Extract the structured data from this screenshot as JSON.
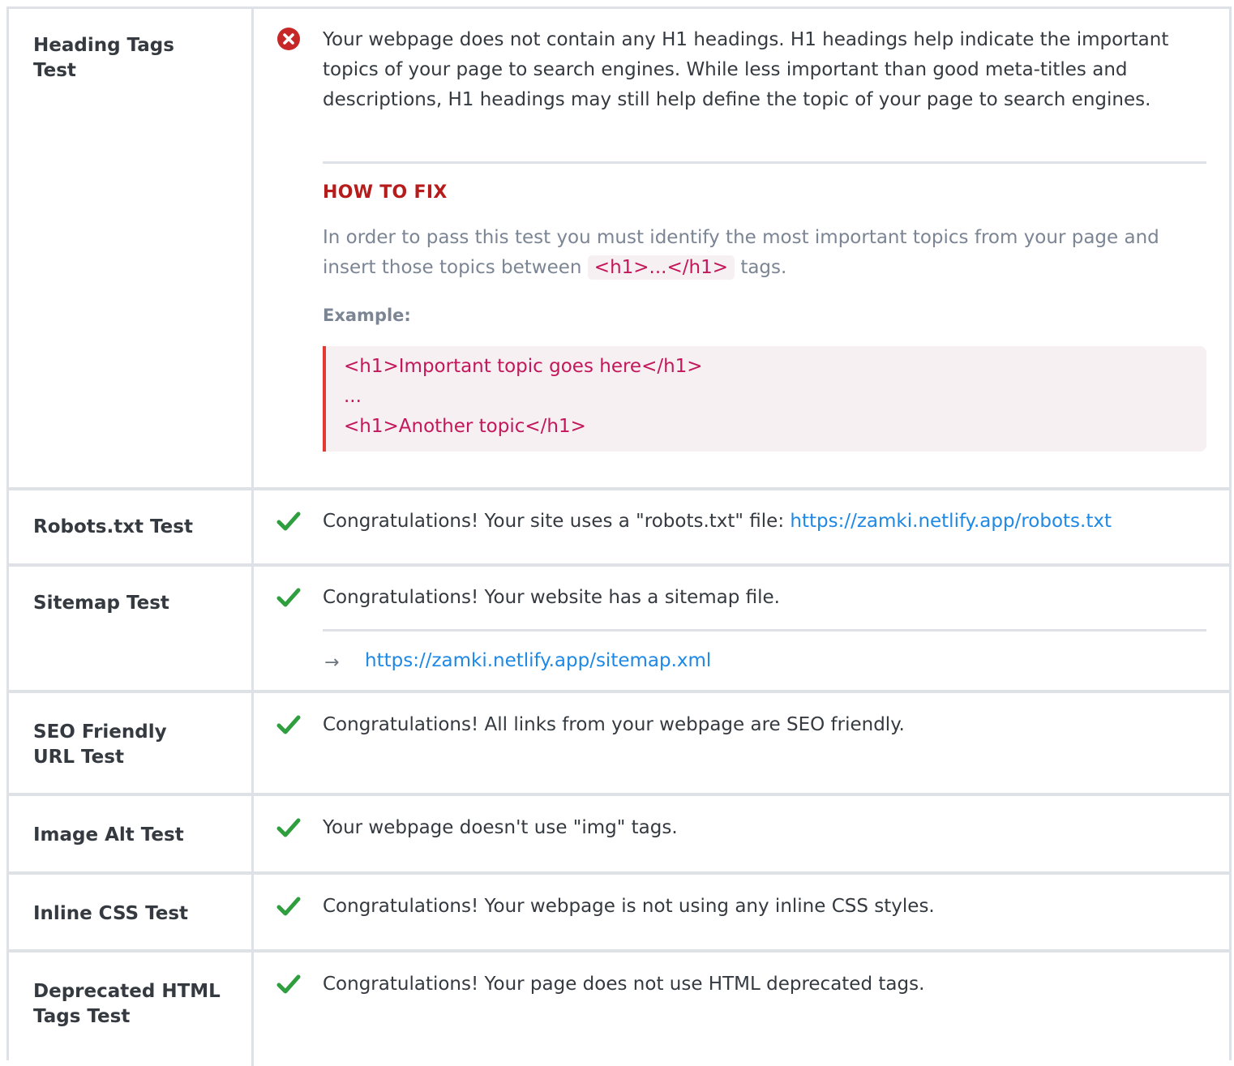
{
  "colors": {
    "fail_icon": "#c62828",
    "pass_icon": "#2e9e3e",
    "link": "#1e88e5",
    "fix_title": "#b71c1c",
    "code": "#c2185b",
    "code_border": "#e53935",
    "border": "#dee2e6"
  },
  "tests": [
    {
      "label": "Heading Tags Test",
      "status": "fail",
      "icon": "x-circle-icon",
      "message": "Your webpage does not contain any H1 headings. H1 headings help indicate the important topics of your page to search engines. While less important than good meta-titles and descriptions, H1 headings may still help define the topic of your page to search engines.",
      "how_to_fix": {
        "title": "HOW TO FIX",
        "text_before": "In order to pass this test you must identify the most important topics from your page and insert those topics between",
        "code": "<h1>...</h1>",
        "text_after": "tags.",
        "example_label": "Example:",
        "example_lines": [
          "<h1>Important topic goes here</h1>",
          "...",
          "<h1>Another topic</h1>"
        ]
      }
    },
    {
      "label": "Robots.txt Test",
      "status": "pass",
      "icon": "check-icon",
      "message": "Congratulations! Your site uses a \"robots.txt\" file:",
      "link": "https://zamki.netlify.app/robots.txt"
    },
    {
      "label": "Sitemap Test",
      "status": "pass",
      "icon": "check-icon",
      "message": "Congratulations! Your website has a sitemap file.",
      "link_icon": "arrow-right-icon",
      "arrow": "→",
      "link": "https://zamki.netlify.app/sitemap.xml"
    },
    {
      "label": "SEO Friendly URL Test",
      "status": "pass",
      "icon": "check-icon",
      "message": "Congratulations! All links from your webpage are SEO friendly."
    },
    {
      "label": "Image Alt Test",
      "status": "pass",
      "icon": "check-icon",
      "message": "Your webpage doesn't use \"img\" tags."
    },
    {
      "label": "Inline CSS Test",
      "status": "pass",
      "icon": "check-icon",
      "message": "Congratulations! Your webpage is not using any inline CSS styles."
    },
    {
      "label": "Deprecated HTML Tags Test",
      "status": "pass",
      "icon": "check-icon",
      "message": "Congratulations! Your page does not use HTML deprecated tags."
    }
  ]
}
